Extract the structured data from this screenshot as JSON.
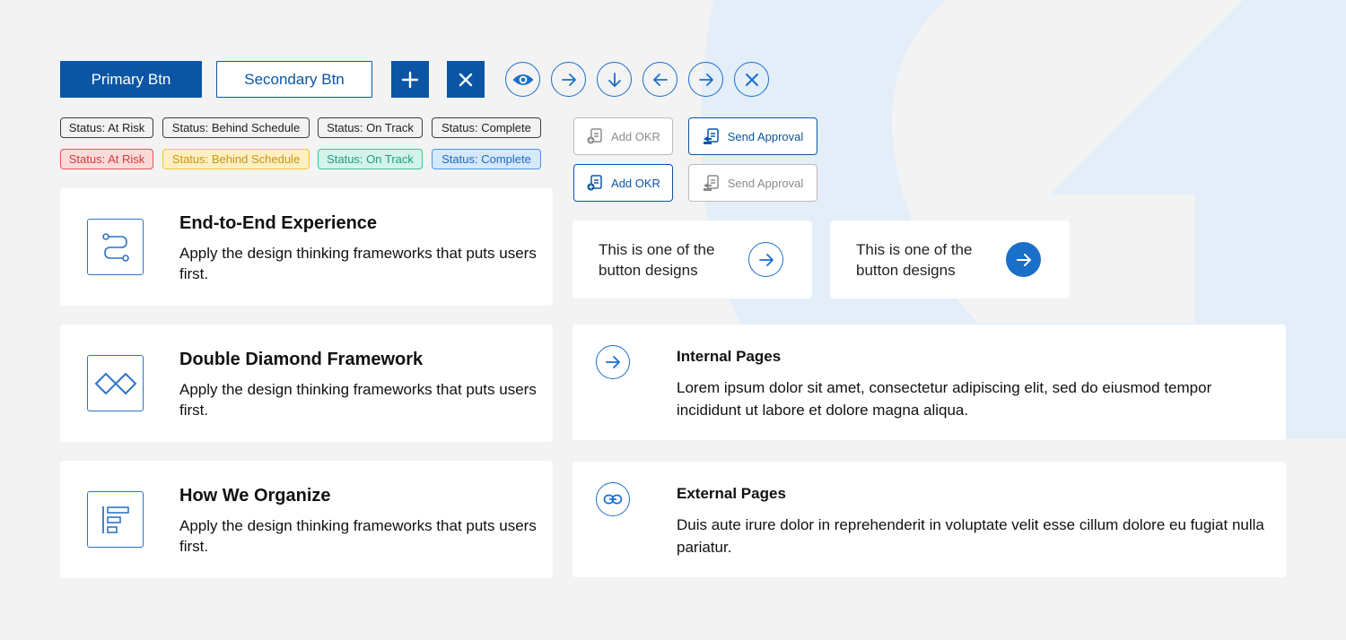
{
  "colors": {
    "primary": "#0b56a4",
    "accent": "#1a6fc9",
    "background": "#f3f3f3",
    "card": "#ffffff"
  },
  "buttons": {
    "primary_label": "Primary Btn",
    "secondary_label": "Secondary Btn",
    "add_icon": "plus-icon",
    "close_icon": "close-icon",
    "icon_buttons": [
      "eye-icon",
      "arrow-right-icon",
      "arrow-down-icon",
      "arrow-left-icon",
      "arrow-right-icon",
      "close-icon"
    ]
  },
  "statuses": {
    "neutral": [
      "Status: At Risk",
      "Status: Behind Schedule",
      "Status: On Track",
      "Status: Complete"
    ],
    "colored": [
      "Status: At Risk",
      "Status: Behind Schedule",
      "Status: On Track",
      "Status: Complete"
    ]
  },
  "actions": {
    "add_okr": "Add OKR",
    "send_approval": "Send Approval"
  },
  "feature_cards": [
    {
      "title": "End-to-End Experience",
      "description": "Apply the design thinking frameworks that puts users first.",
      "icon": "route-icon"
    },
    {
      "title": "Double Diamond Framework",
      "description": "Apply the design thinking frameworks that puts users first.",
      "icon": "double-diamond-icon"
    },
    {
      "title": "How We Organize",
      "description": "Apply the design thinking frameworks that puts users first.",
      "icon": "organize-icon"
    }
  ],
  "cta_cards": [
    {
      "text": "This is one of the button designs",
      "style": "outline"
    },
    {
      "text": "This is one of the button designs",
      "style": "filled"
    }
  ],
  "link_cards": [
    {
      "title": "Internal Pages",
      "description": "Lorem ipsum dolor sit amet, consectetur adipiscing elit, sed do eiusmod tempor incididunt ut labore et dolore magna aliqua.",
      "icon": "arrow-right-icon"
    },
    {
      "title": "External Pages",
      "description": "Duis aute irure dolor in reprehenderit in voluptate velit esse cillum dolore eu fugiat nulla pariatur.",
      "icon": "link-icon"
    }
  ]
}
